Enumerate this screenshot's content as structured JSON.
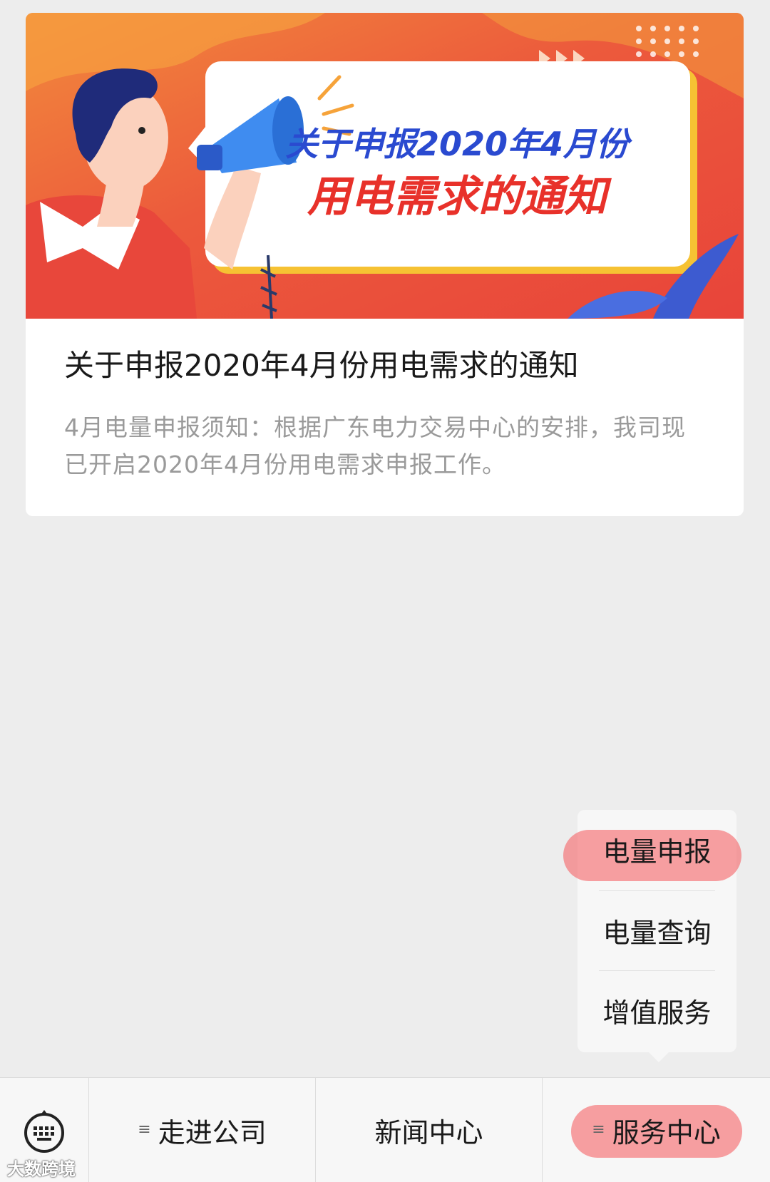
{
  "article": {
    "banner_line1": "关于申报2020年4月份",
    "banner_line2": "用电需求的通知",
    "title": "关于申报2020年4月份用电需求的通知",
    "description": "4月电量申报须知：根据广东电力交易中心的安排，我司现已开启2020年4月份用电需求申报工作。"
  },
  "popup_menu": {
    "items": [
      "电量申报",
      "电量查询",
      "增值服务"
    ],
    "highlighted_index": 0
  },
  "tab_bar": {
    "keyboard_icon": "keyboard-icon",
    "tabs": [
      {
        "label": "走进公司",
        "has_menu_icon": true
      },
      {
        "label": "新闻中心",
        "has_menu_icon": false
      },
      {
        "label": "服务中心",
        "has_menu_icon": true
      }
    ],
    "highlighted_index": 2
  },
  "watermark": "大数跨境",
  "colors": {
    "banner_red": "#ea4a3b",
    "banner_orange": "#f7953a",
    "banner_text_blue": "#2a4ad0",
    "banner_text_red": "#e8312a",
    "highlight": "#f5555a"
  }
}
